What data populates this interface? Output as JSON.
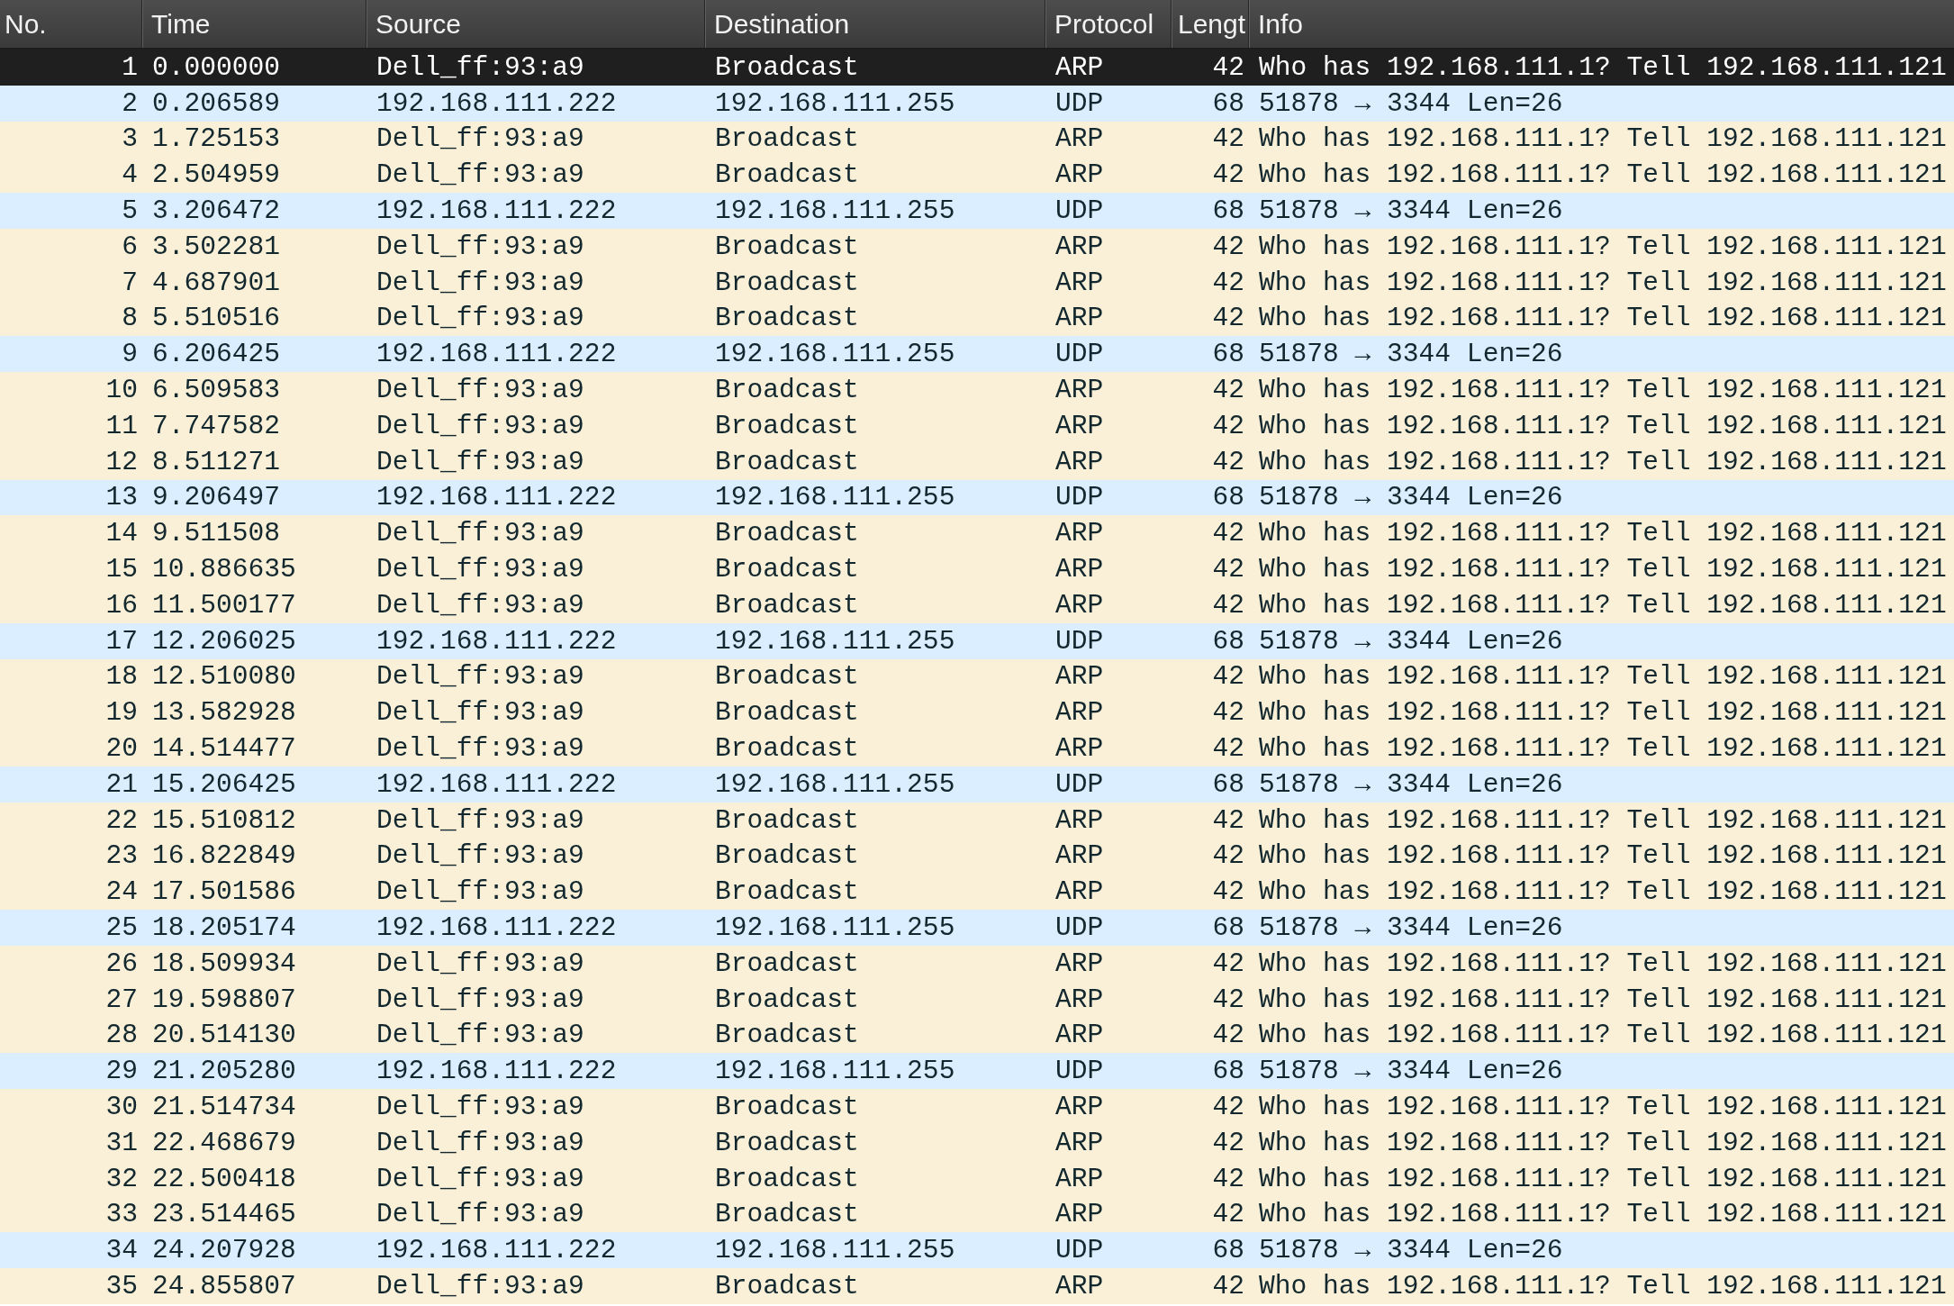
{
  "table": {
    "columns": [
      "No.",
      "Time",
      "Source",
      "Destination",
      "Protocol",
      "Lengt",
      "Info"
    ],
    "rows": [
      {
        "no": "1",
        "time": "0.000000",
        "source": "Dell_ff:93:a9",
        "destination": "Broadcast",
        "protocol": "ARP",
        "length": "42",
        "info": "Who has 192.168.111.1? Tell 192.168.111.121",
        "selected": true
      },
      {
        "no": "2",
        "time": "0.206589",
        "source": "192.168.111.222",
        "destination": "192.168.111.255",
        "protocol": "UDP",
        "length": "68",
        "info": "51878 → 3344 Len=26",
        "selected": false,
        "color": "#daeeff"
      },
      {
        "no": "3",
        "time": "1.725153",
        "source": "Dell_ff:93:a9",
        "destination": "Broadcast",
        "protocol": "ARP",
        "length": "42",
        "info": "Who has 192.168.111.1? Tell 192.168.111.121",
        "selected": false,
        "color": "#faf0d7"
      },
      {
        "no": "4",
        "time": "2.504959",
        "source": "Dell_ff:93:a9",
        "destination": "Broadcast",
        "protocol": "ARP",
        "length": "42",
        "info": "Who has 192.168.111.1? Tell 192.168.111.121",
        "selected": false,
        "color": "#faf0d7"
      },
      {
        "no": "5",
        "time": "3.206472",
        "source": "192.168.111.222",
        "destination": "192.168.111.255",
        "protocol": "UDP",
        "length": "68",
        "info": "51878 → 3344 Len=26",
        "selected": false,
        "color": "#daeeff"
      },
      {
        "no": "6",
        "time": "3.502281",
        "source": "Dell_ff:93:a9",
        "destination": "Broadcast",
        "protocol": "ARP",
        "length": "42",
        "info": "Who has 192.168.111.1? Tell 192.168.111.121",
        "selected": false,
        "color": "#faf0d7"
      },
      {
        "no": "7",
        "time": "4.687901",
        "source": "Dell_ff:93:a9",
        "destination": "Broadcast",
        "protocol": "ARP",
        "length": "42",
        "info": "Who has 192.168.111.1? Tell 192.168.111.121",
        "selected": false,
        "color": "#faf0d7"
      },
      {
        "no": "8",
        "time": "5.510516",
        "source": "Dell_ff:93:a9",
        "destination": "Broadcast",
        "protocol": "ARP",
        "length": "42",
        "info": "Who has 192.168.111.1? Tell 192.168.111.121",
        "selected": false,
        "color": "#faf0d7"
      },
      {
        "no": "9",
        "time": "6.206425",
        "source": "192.168.111.222",
        "destination": "192.168.111.255",
        "protocol": "UDP",
        "length": "68",
        "info": "51878 → 3344 Len=26",
        "selected": false,
        "color": "#daeeff"
      },
      {
        "no": "10",
        "time": "6.509583",
        "source": "Dell_ff:93:a9",
        "destination": "Broadcast",
        "protocol": "ARP",
        "length": "42",
        "info": "Who has 192.168.111.1? Tell 192.168.111.121",
        "selected": false,
        "color": "#faf0d7"
      },
      {
        "no": "11",
        "time": "7.747582",
        "source": "Dell_ff:93:a9",
        "destination": "Broadcast",
        "protocol": "ARP",
        "length": "42",
        "info": "Who has 192.168.111.1? Tell 192.168.111.121",
        "selected": false,
        "color": "#faf0d7"
      },
      {
        "no": "12",
        "time": "8.511271",
        "source": "Dell_ff:93:a9",
        "destination": "Broadcast",
        "protocol": "ARP",
        "length": "42",
        "info": "Who has 192.168.111.1? Tell 192.168.111.121",
        "selected": false,
        "color": "#faf0d7"
      },
      {
        "no": "13",
        "time": "9.206497",
        "source": "192.168.111.222",
        "destination": "192.168.111.255",
        "protocol": "UDP",
        "length": "68",
        "info": "51878 → 3344 Len=26",
        "selected": false,
        "color": "#daeeff"
      },
      {
        "no": "14",
        "time": "9.511508",
        "source": "Dell_ff:93:a9",
        "destination": "Broadcast",
        "protocol": "ARP",
        "length": "42",
        "info": "Who has 192.168.111.1? Tell 192.168.111.121",
        "selected": false,
        "color": "#faf0d7"
      },
      {
        "no": "15",
        "time": "10.886635",
        "source": "Dell_ff:93:a9",
        "destination": "Broadcast",
        "protocol": "ARP",
        "length": "42",
        "info": "Who has 192.168.111.1? Tell 192.168.111.121",
        "selected": false,
        "color": "#faf0d7"
      },
      {
        "no": "16",
        "time": "11.500177",
        "source": "Dell_ff:93:a9",
        "destination": "Broadcast",
        "protocol": "ARP",
        "length": "42",
        "info": "Who has 192.168.111.1? Tell 192.168.111.121",
        "selected": false,
        "color": "#faf0d7"
      },
      {
        "no": "17",
        "time": "12.206025",
        "source": "192.168.111.222",
        "destination": "192.168.111.255",
        "protocol": "UDP",
        "length": "68",
        "info": "51878 → 3344 Len=26",
        "selected": false,
        "color": "#daeeff"
      },
      {
        "no": "18",
        "time": "12.510080",
        "source": "Dell_ff:93:a9",
        "destination": "Broadcast",
        "protocol": "ARP",
        "length": "42",
        "info": "Who has 192.168.111.1? Tell 192.168.111.121",
        "selected": false,
        "color": "#faf0d7"
      },
      {
        "no": "19",
        "time": "13.582928",
        "source": "Dell_ff:93:a9",
        "destination": "Broadcast",
        "protocol": "ARP",
        "length": "42",
        "info": "Who has 192.168.111.1? Tell 192.168.111.121",
        "selected": false,
        "color": "#faf0d7"
      },
      {
        "no": "20",
        "time": "14.514477",
        "source": "Dell_ff:93:a9",
        "destination": "Broadcast",
        "protocol": "ARP",
        "length": "42",
        "info": "Who has 192.168.111.1? Tell 192.168.111.121",
        "selected": false,
        "color": "#faf0d7"
      },
      {
        "no": "21",
        "time": "15.206425",
        "source": "192.168.111.222",
        "destination": "192.168.111.255",
        "protocol": "UDP",
        "length": "68",
        "info": "51878 → 3344 Len=26",
        "selected": false,
        "color": "#daeeff"
      },
      {
        "no": "22",
        "time": "15.510812",
        "source": "Dell_ff:93:a9",
        "destination": "Broadcast",
        "protocol": "ARP",
        "length": "42",
        "info": "Who has 192.168.111.1? Tell 192.168.111.121",
        "selected": false,
        "color": "#faf0d7"
      },
      {
        "no": "23",
        "time": "16.822849",
        "source": "Dell_ff:93:a9",
        "destination": "Broadcast",
        "protocol": "ARP",
        "length": "42",
        "info": "Who has 192.168.111.1? Tell 192.168.111.121",
        "selected": false,
        "color": "#faf0d7"
      },
      {
        "no": "24",
        "time": "17.501586",
        "source": "Dell_ff:93:a9",
        "destination": "Broadcast",
        "protocol": "ARP",
        "length": "42",
        "info": "Who has 192.168.111.1? Tell 192.168.111.121",
        "selected": false,
        "color": "#faf0d7"
      },
      {
        "no": "25",
        "time": "18.205174",
        "source": "192.168.111.222",
        "destination": "192.168.111.255",
        "protocol": "UDP",
        "length": "68",
        "info": "51878 → 3344 Len=26",
        "selected": false,
        "color": "#daeeff"
      },
      {
        "no": "26",
        "time": "18.509934",
        "source": "Dell_ff:93:a9",
        "destination": "Broadcast",
        "protocol": "ARP",
        "length": "42",
        "info": "Who has 192.168.111.1? Tell 192.168.111.121",
        "selected": false,
        "color": "#faf0d7"
      },
      {
        "no": "27",
        "time": "19.598807",
        "source": "Dell_ff:93:a9",
        "destination": "Broadcast",
        "protocol": "ARP",
        "length": "42",
        "info": "Who has 192.168.111.1? Tell 192.168.111.121",
        "selected": false,
        "color": "#faf0d7"
      },
      {
        "no": "28",
        "time": "20.514130",
        "source": "Dell_ff:93:a9",
        "destination": "Broadcast",
        "protocol": "ARP",
        "length": "42",
        "info": "Who has 192.168.111.1? Tell 192.168.111.121",
        "selected": false,
        "color": "#faf0d7"
      },
      {
        "no": "29",
        "time": "21.205280",
        "source": "192.168.111.222",
        "destination": "192.168.111.255",
        "protocol": "UDP",
        "length": "68",
        "info": "51878 → 3344 Len=26",
        "selected": false,
        "color": "#daeeff"
      },
      {
        "no": "30",
        "time": "21.514734",
        "source": "Dell_ff:93:a9",
        "destination": "Broadcast",
        "protocol": "ARP",
        "length": "42",
        "info": "Who has 192.168.111.1? Tell 192.168.111.121",
        "selected": false,
        "color": "#faf0d7"
      },
      {
        "no": "31",
        "time": "22.468679",
        "source": "Dell_ff:93:a9",
        "destination": "Broadcast",
        "protocol": "ARP",
        "length": "42",
        "info": "Who has 192.168.111.1? Tell 192.168.111.121",
        "selected": false,
        "color": "#faf0d7"
      },
      {
        "no": "32",
        "time": "22.500418",
        "source": "Dell_ff:93:a9",
        "destination": "Broadcast",
        "protocol": "ARP",
        "length": "42",
        "info": "Who has 192.168.111.1? Tell 192.168.111.121",
        "selected": false,
        "color": "#faf0d7"
      },
      {
        "no": "33",
        "time": "23.514465",
        "source": "Dell_ff:93:a9",
        "destination": "Broadcast",
        "protocol": "ARP",
        "length": "42",
        "info": "Who has 192.168.111.1? Tell 192.168.111.121",
        "selected": false,
        "color": "#faf0d7"
      },
      {
        "no": "34",
        "time": "24.207928",
        "source": "192.168.111.222",
        "destination": "192.168.111.255",
        "protocol": "UDP",
        "length": "68",
        "info": "51878 → 3344 Len=26",
        "selected": false,
        "color": "#daeeff"
      },
      {
        "no": "35",
        "time": "24.855807",
        "source": "Dell_ff:93:a9",
        "destination": "Broadcast",
        "protocol": "ARP",
        "length": "42",
        "info": "Who has 192.168.111.1? Tell 192.168.111.121",
        "selected": false,
        "color": "#faf0d7"
      }
    ]
  }
}
